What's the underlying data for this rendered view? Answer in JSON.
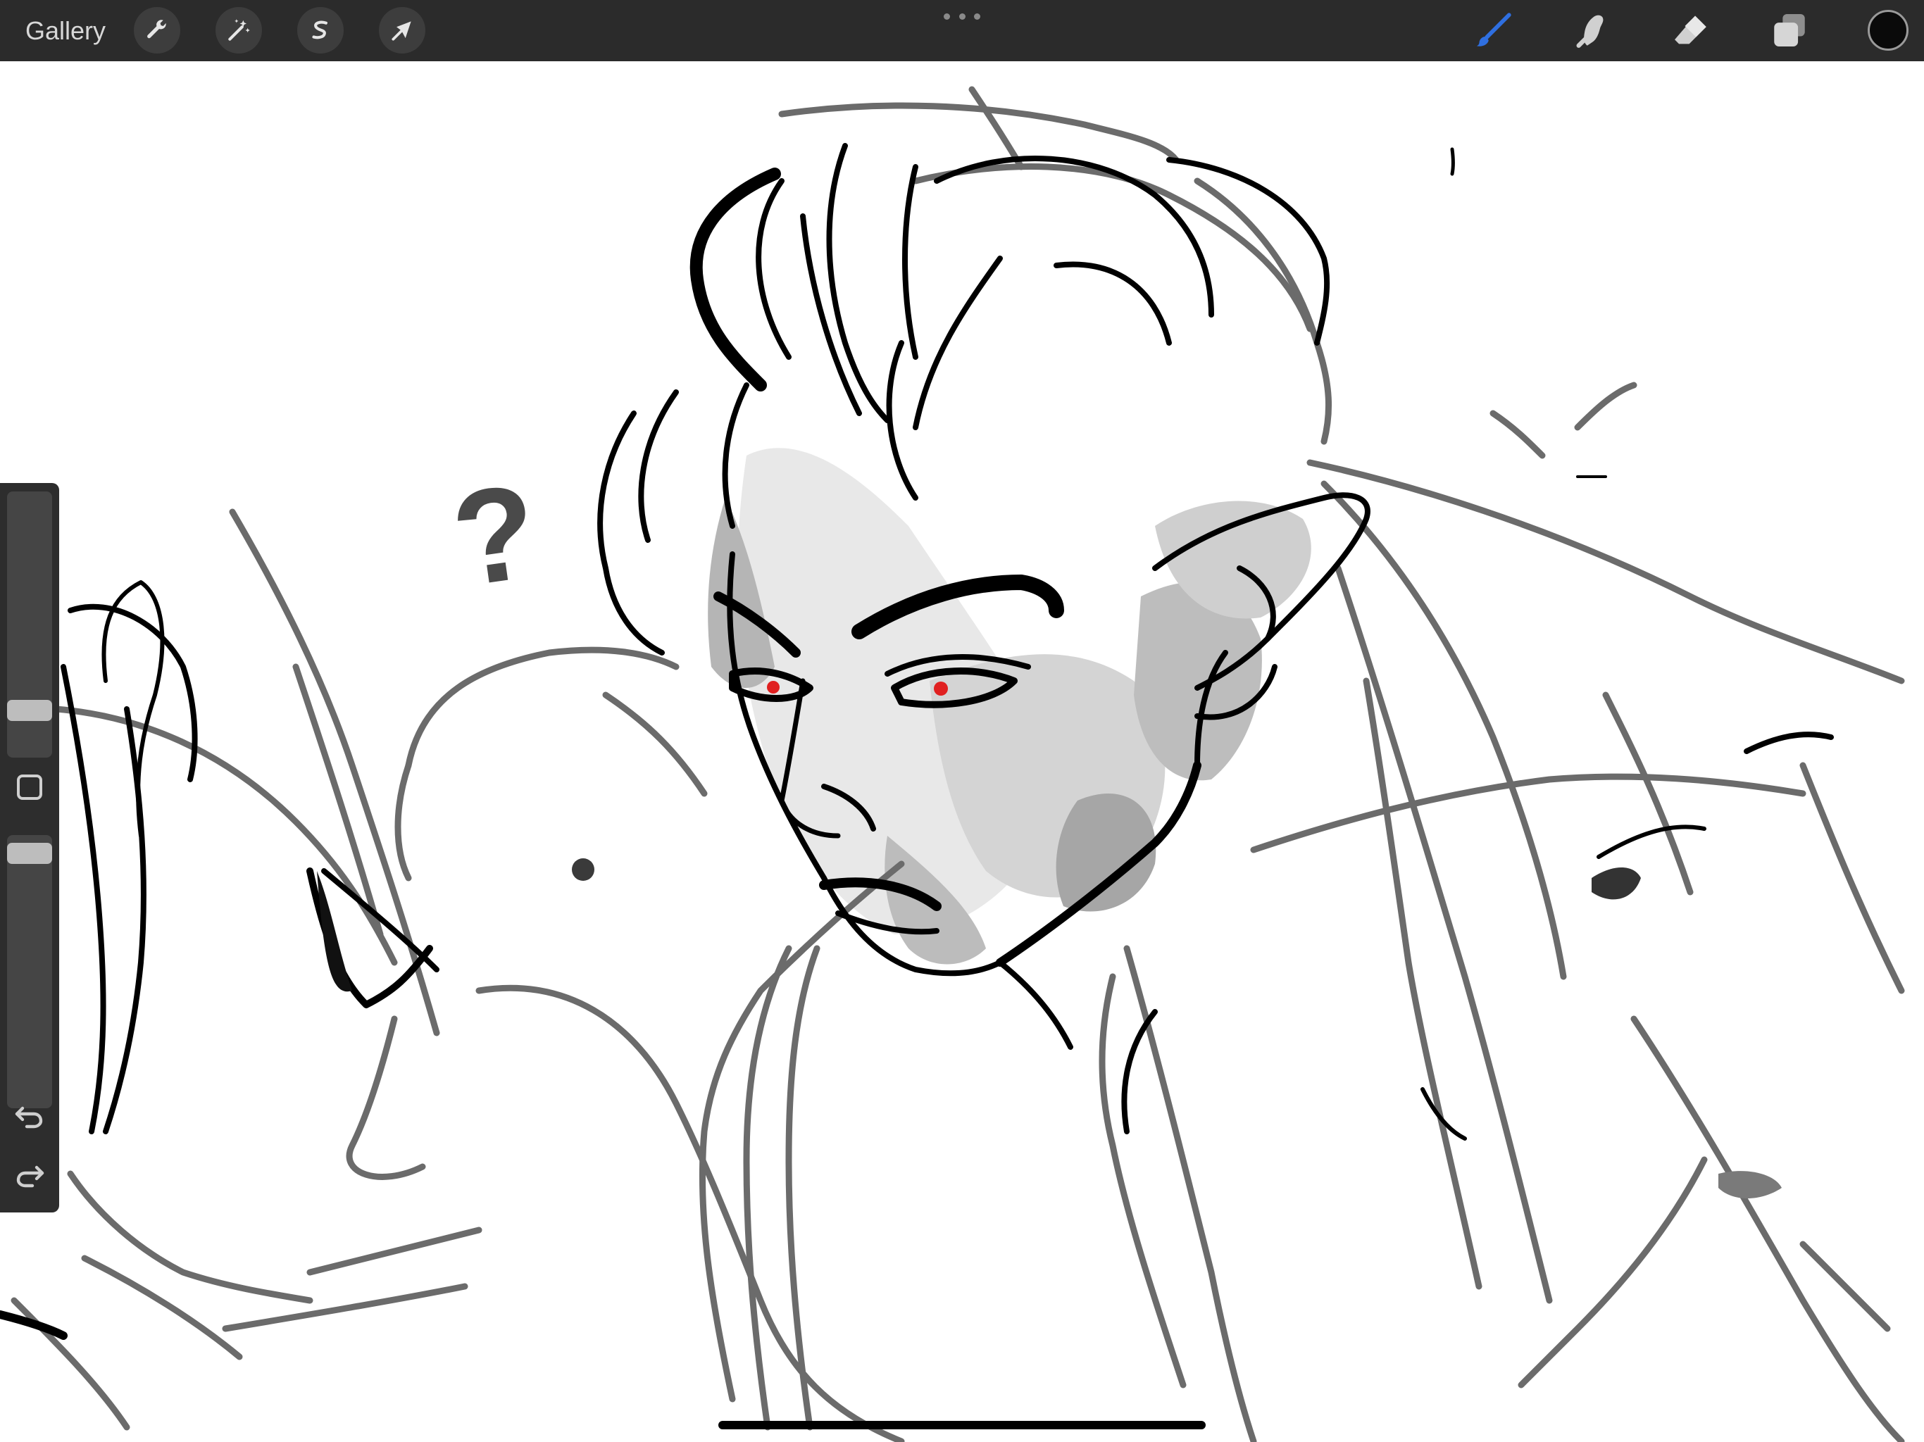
{
  "toolbar": {
    "gallery_label": "Gallery",
    "left_tools": [
      {
        "name": "actions",
        "icon": "wrench-icon"
      },
      {
        "name": "adjustments",
        "icon": "magic-wand-icon"
      },
      {
        "name": "selection",
        "icon": "selection-s-icon"
      },
      {
        "name": "transform",
        "icon": "arrow-cursor-icon"
      }
    ],
    "more_icon": "ellipsis-icon",
    "right_tools": [
      {
        "name": "brush",
        "icon": "brush-icon",
        "active": true
      },
      {
        "name": "smudge",
        "icon": "smudge-icon",
        "active": false
      },
      {
        "name": "eraser",
        "icon": "eraser-icon",
        "active": false
      },
      {
        "name": "layers",
        "icon": "layers-icon",
        "active": false
      }
    ],
    "current_color": "#0a0a0a",
    "active_tool_color": "#2f6fe0"
  },
  "sidebar": {
    "brush_size_level": 0.15,
    "opacity_level": 0.97,
    "modify_icon": "square-modify-icon",
    "undo_icon": "undo-icon",
    "redo_icon": "redo-icon"
  },
  "canvas": {
    "background": "#ffffff",
    "ink": "#000000",
    "eye_color": "#e02020",
    "question_mark": "?"
  }
}
